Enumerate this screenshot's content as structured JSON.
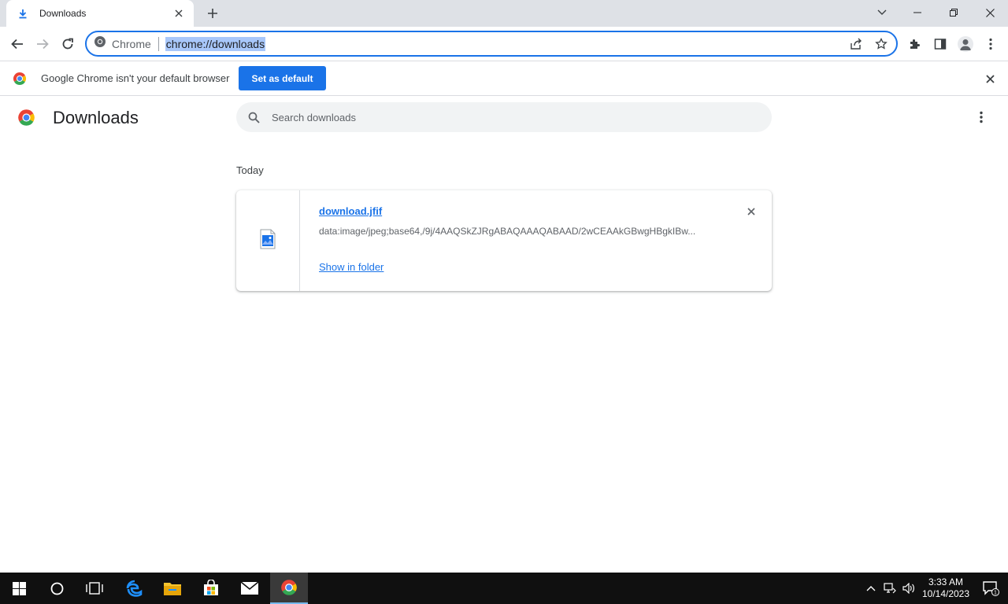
{
  "tab": {
    "title": "Downloads",
    "icon": "download-icon"
  },
  "omnibox": {
    "site_label": "Chrome",
    "url": "chrome://downloads"
  },
  "infobar": {
    "text": "Google Chrome isn't your default browser",
    "button": "Set as default"
  },
  "page": {
    "title": "Downloads",
    "search_placeholder": "Search downloads",
    "section_date": "Today",
    "items": [
      {
        "file_name": "download.jfif",
        "url": "data:image/jpeg;base64,/9j/4AAQSkZJRgABAQAAAQABAAD/2wCEAAkGBwgHBgkIBw...",
        "action": "Show in folder",
        "icon": "image-file-icon"
      }
    ]
  },
  "taskbar": {
    "items": [
      "start-icon",
      "search-icon",
      "task-view-icon",
      "edge-icon",
      "file-explorer-icon",
      "store-icon",
      "mail-icon",
      "chrome-icon"
    ],
    "clock_time": "3:33 AM",
    "clock_date": "10/14/2023",
    "notification_count": "1"
  },
  "colors": {
    "accent": "#1a73e8",
    "tabstrip": "#dee1e6",
    "selection": "#a8c7fa",
    "taskbar": "#101010"
  }
}
